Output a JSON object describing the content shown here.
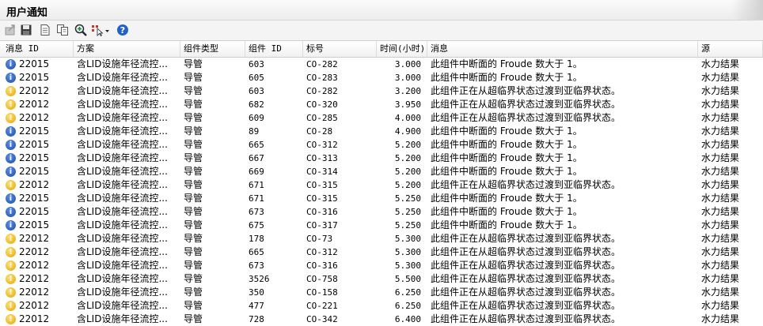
{
  "window": {
    "title": "用户通知"
  },
  "toolbar": {
    "buttons": [
      {
        "name": "export-icon"
      },
      {
        "name": "save-icon"
      },
      {
        "name": "document-icon"
      },
      {
        "name": "copy-icon"
      },
      {
        "name": "zoom-icon"
      },
      {
        "name": "select-dropdown-icon"
      },
      {
        "name": "help-icon"
      }
    ]
  },
  "columns": {
    "msg_id": "消息 ID",
    "scenario": "方案",
    "comp_type": "组件类型",
    "comp_id": "组件 ID",
    "label": "标号",
    "time": "时间(小时)",
    "message": "消息",
    "source": "源"
  },
  "messages": {
    "info": "此组件中断面的 Froude 数大于 1。",
    "warn": "此组件正在从超临界状态过渡到亚临界状态。"
  },
  "rows": [
    {
      "type": "info",
      "msg_id": "22015",
      "scenario": "含LID设施年径流控...",
      "comp_type": "导管",
      "comp_id": "603",
      "label": "CO-282",
      "time": "3.000",
      "message": "此组件中断面的 Froude 数大于 1。",
      "source": "水力结果"
    },
    {
      "type": "info",
      "msg_id": "22015",
      "scenario": "含LID设施年径流控...",
      "comp_type": "导管",
      "comp_id": "605",
      "label": "CO-283",
      "time": "3.000",
      "message": "此组件中断面的 Froude 数大于 1。",
      "source": "水力结果"
    },
    {
      "type": "warn",
      "msg_id": "22012",
      "scenario": "含LID设施年径流控...",
      "comp_type": "导管",
      "comp_id": "603",
      "label": "CO-282",
      "time": "3.200",
      "message": "此组件正在从超临界状态过渡到亚临界状态。",
      "source": "水力结果"
    },
    {
      "type": "warn",
      "msg_id": "22012",
      "scenario": "含LID设施年径流控...",
      "comp_type": "导管",
      "comp_id": "682",
      "label": "CO-320",
      "time": "3.950",
      "message": "此组件正在从超临界状态过渡到亚临界状态。",
      "source": "水力结果"
    },
    {
      "type": "warn",
      "msg_id": "22012",
      "scenario": "含LID设施年径流控...",
      "comp_type": "导管",
      "comp_id": "609",
      "label": "CO-285",
      "time": "4.000",
      "message": "此组件正在从超临界状态过渡到亚临界状态。",
      "source": "水力结果"
    },
    {
      "type": "info",
      "msg_id": "22015",
      "scenario": "含LID设施年径流控...",
      "comp_type": "导管",
      "comp_id": "89",
      "label": "CO-28",
      "time": "4.900",
      "message": "此组件中断面的 Froude 数大于 1。",
      "source": "水力结果"
    },
    {
      "type": "info",
      "msg_id": "22015",
      "scenario": "含LID设施年径流控...",
      "comp_type": "导管",
      "comp_id": "665",
      "label": "CO-312",
      "time": "5.200",
      "message": "此组件中断面的 Froude 数大于 1。",
      "source": "水力结果"
    },
    {
      "type": "info",
      "msg_id": "22015",
      "scenario": "含LID设施年径流控...",
      "comp_type": "导管",
      "comp_id": "667",
      "label": "CO-313",
      "time": "5.200",
      "message": "此组件中断面的 Froude 数大于 1。",
      "source": "水力结果"
    },
    {
      "type": "info",
      "msg_id": "22015",
      "scenario": "含LID设施年径流控...",
      "comp_type": "导管",
      "comp_id": "669",
      "label": "CO-314",
      "time": "5.200",
      "message": "此组件中断面的 Froude 数大于 1。",
      "source": "水力结果"
    },
    {
      "type": "warn",
      "msg_id": "22012",
      "scenario": "含LID设施年径流控...",
      "comp_type": "导管",
      "comp_id": "671",
      "label": "CO-315",
      "time": "5.200",
      "message": "此组件正在从超临界状态过渡到亚临界状态。",
      "source": "水力结果"
    },
    {
      "type": "info",
      "msg_id": "22015",
      "scenario": "含LID设施年径流控...",
      "comp_type": "导管",
      "comp_id": "671",
      "label": "CO-315",
      "time": "5.250",
      "message": "此组件中断面的 Froude 数大于 1。",
      "source": "水力结果"
    },
    {
      "type": "info",
      "msg_id": "22015",
      "scenario": "含LID设施年径流控...",
      "comp_type": "导管",
      "comp_id": "673",
      "label": "CO-316",
      "time": "5.250",
      "message": "此组件中断面的 Froude 数大于 1。",
      "source": "水力结果"
    },
    {
      "type": "info",
      "msg_id": "22015",
      "scenario": "含LID设施年径流控...",
      "comp_type": "导管",
      "comp_id": "675",
      "label": "CO-317",
      "time": "5.250",
      "message": "此组件中断面的 Froude 数大于 1。",
      "source": "水力结果"
    },
    {
      "type": "warn",
      "msg_id": "22012",
      "scenario": "含LID设施年径流控...",
      "comp_type": "导管",
      "comp_id": "178",
      "label": "CO-73",
      "time": "5.300",
      "message": "此组件正在从超临界状态过渡到亚临界状态。",
      "source": "水力结果"
    },
    {
      "type": "warn",
      "msg_id": "22012",
      "scenario": "含LID设施年径流控...",
      "comp_type": "导管",
      "comp_id": "665",
      "label": "CO-312",
      "time": "5.300",
      "message": "此组件正在从超临界状态过渡到亚临界状态。",
      "source": "水力结果"
    },
    {
      "type": "warn",
      "msg_id": "22012",
      "scenario": "含LID设施年径流控...",
      "comp_type": "导管",
      "comp_id": "673",
      "label": "CO-316",
      "time": "5.300",
      "message": "此组件正在从超临界状态过渡到亚临界状态。",
      "source": "水力结果"
    },
    {
      "type": "warn",
      "msg_id": "22012",
      "scenario": "含LID设施年径流控...",
      "comp_type": "导管",
      "comp_id": "3526",
      "label": "CO-758",
      "time": "5.500",
      "message": "此组件正在从超临界状态过渡到亚临界状态。",
      "source": "水力结果"
    },
    {
      "type": "warn",
      "msg_id": "22012",
      "scenario": "含LID设施年径流控...",
      "comp_type": "导管",
      "comp_id": "350",
      "label": "CO-158",
      "time": "6.250",
      "message": "此组件正在从超临界状态过渡到亚临界状态。",
      "source": "水力结果"
    },
    {
      "type": "warn",
      "msg_id": "22012",
      "scenario": "含LID设施年径流控...",
      "comp_type": "导管",
      "comp_id": "477",
      "label": "CO-221",
      "time": "6.250",
      "message": "此组件正在从超临界状态过渡到亚临界状态。",
      "source": "水力结果"
    },
    {
      "type": "warn",
      "msg_id": "22012",
      "scenario": "含LID设施年径流控...",
      "comp_type": "导管",
      "comp_id": "728",
      "label": "CO-342",
      "time": "6.400",
      "message": "此组件正在从超临界状态过渡到亚临界状态。",
      "source": "水力结果"
    }
  ]
}
